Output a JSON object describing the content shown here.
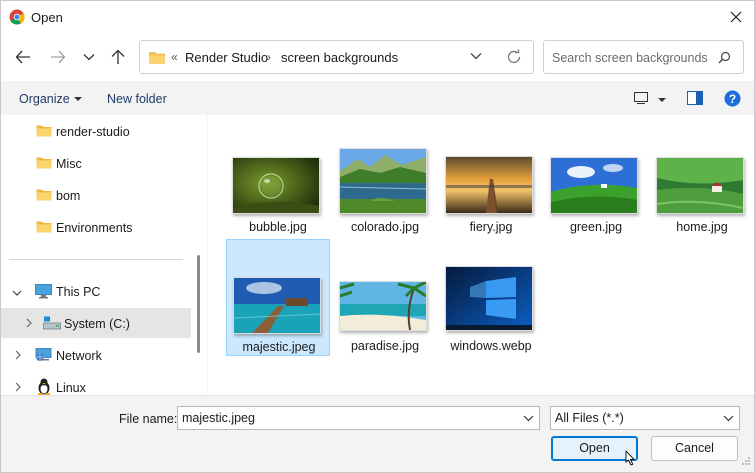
{
  "window": {
    "title": "Open",
    "app_icon": "chrome-icon"
  },
  "nav": {
    "back": "back-arrow-icon",
    "forward": "forward-arrow-icon",
    "recent": "chevron-down-icon",
    "up": "up-arrow-icon"
  },
  "address": {
    "overflow": "«",
    "crumbs": [
      "Render Studio",
      "screen backgrounds"
    ],
    "separator": "›"
  },
  "search": {
    "placeholder": "Search screen backgrounds"
  },
  "commands": {
    "organize": "Organize",
    "new_folder": "New folder"
  },
  "tree": [
    {
      "label": "render-studio",
      "icon": "folder-icon"
    },
    {
      "label": "Misc",
      "icon": "folder-icon"
    },
    {
      "label": "bom",
      "icon": "folder-icon"
    },
    {
      "label": "Environments",
      "icon": "folder-icon"
    },
    {
      "label": "This PC",
      "icon": "pc-icon",
      "expanded": true
    },
    {
      "label": "System (C:)",
      "icon": "drive-icon",
      "selected": true
    },
    {
      "label": "Network",
      "icon": "network-icon"
    },
    {
      "label": "Linux",
      "icon": "linux-icon"
    }
  ],
  "files": [
    {
      "name": "bubble.jpg"
    },
    {
      "name": "colorado.jpg"
    },
    {
      "name": "fiery.jpg"
    },
    {
      "name": "green.jpg"
    },
    {
      "name": "home.jpg"
    },
    {
      "name": "majestic.jpeg",
      "selected": true
    },
    {
      "name": "paradise.jpg"
    },
    {
      "name": "windows.webp"
    }
  ],
  "bottom": {
    "file_name_label": "File name:",
    "file_name_value": "majestic.jpeg",
    "file_type": "All Files (*.*)",
    "open": "Open",
    "cancel": "Cancel"
  },
  "colors": {
    "accent": "#0078d4",
    "selection": "#cce8ff",
    "folder": "#f8c24a"
  }
}
